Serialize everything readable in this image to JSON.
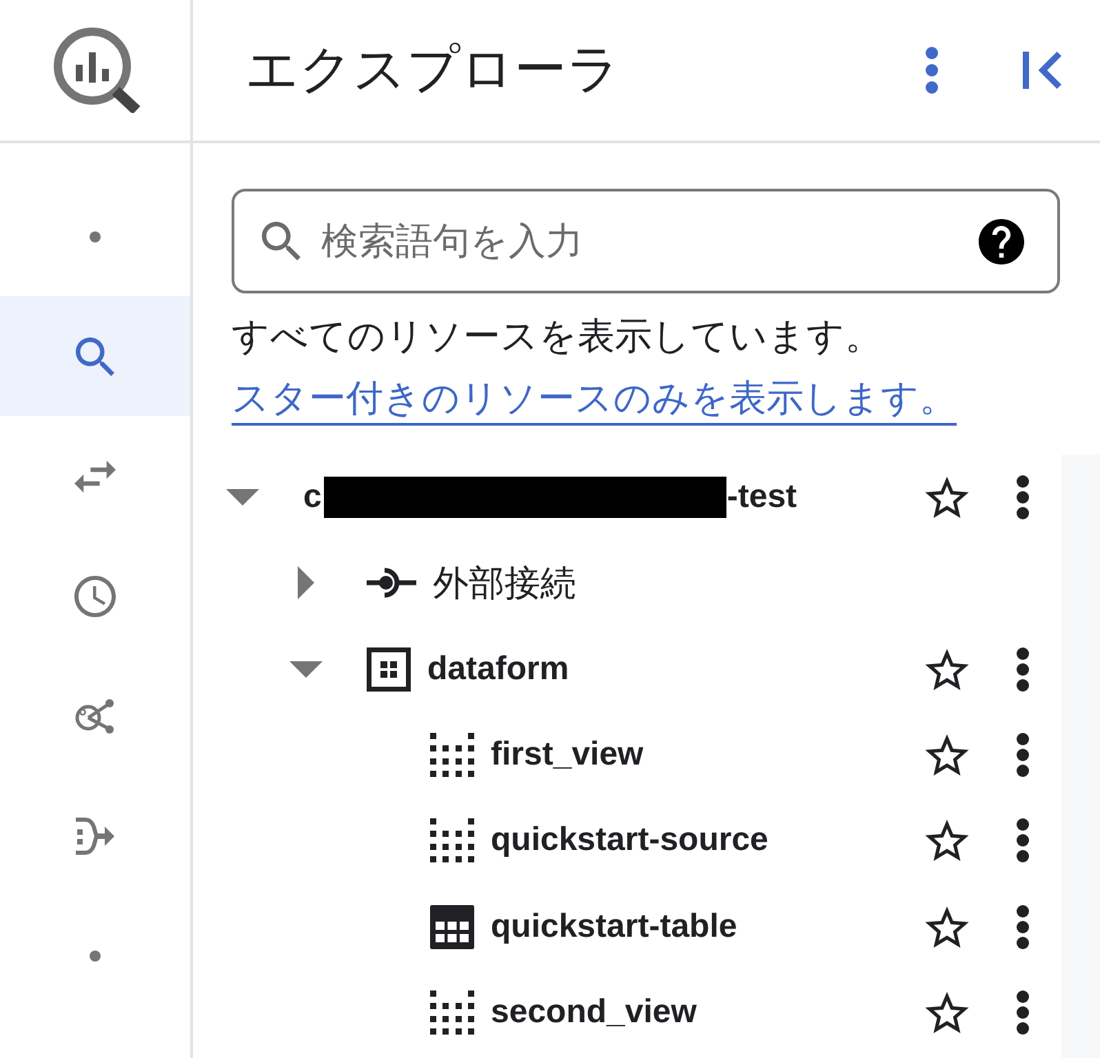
{
  "rail_items": [
    {
      "kind": "dot",
      "selected": false
    },
    {
      "kind": "search",
      "selected": true
    },
    {
      "kind": "transfer",
      "selected": false
    },
    {
      "kind": "history",
      "selected": false
    },
    {
      "kind": "graph",
      "selected": false
    },
    {
      "kind": "pipeline",
      "selected": false
    },
    {
      "kind": "dot",
      "selected": false
    }
  ],
  "explorer": {
    "title": "エクスプローラ"
  },
  "search": {
    "placeholder": "検索語句を入力"
  },
  "filter_notice": {
    "text": "すべてのリソースを表示しています。",
    "link": "スター付きのリソースのみを表示します。"
  },
  "tree": [
    {
      "kind": "project",
      "label": "c",
      "redacted": true,
      "suffix": "-test",
      "expanded": true,
      "starred": false,
      "menu": true,
      "children": [
        {
          "kind": "connection",
          "label": "外部接続",
          "expanded": false
        },
        {
          "kind": "dataset",
          "label": "dataform",
          "expanded": true,
          "starred": false,
          "menu": true,
          "children": [
            {
              "kind": "view",
              "label": "first_view",
              "starred": false,
              "menu": true
            },
            {
              "kind": "view",
              "label": "quickstart-source",
              "starred": false,
              "menu": true
            },
            {
              "kind": "table",
              "label": "quickstart-table",
              "starred": false,
              "menu": true
            },
            {
              "kind": "view",
              "label": "second_view",
              "starred": false,
              "menu": true
            }
          ]
        }
      ]
    }
  ]
}
